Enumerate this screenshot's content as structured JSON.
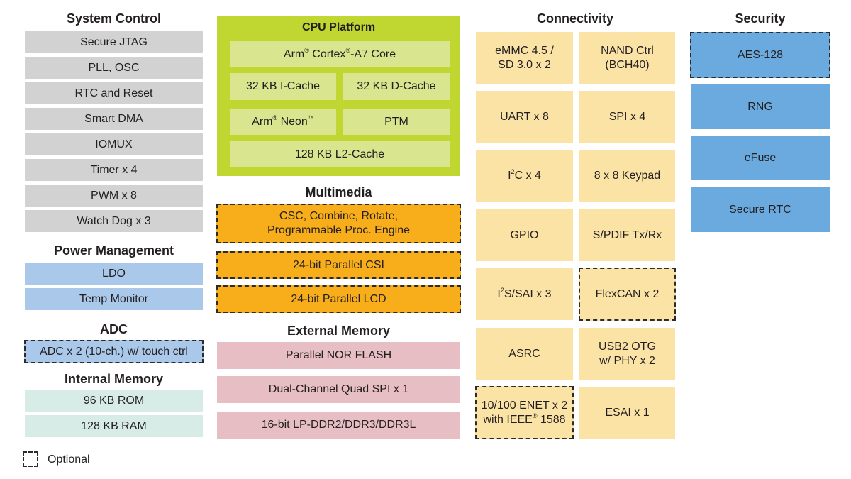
{
  "system_control": {
    "title": "System Control",
    "items": [
      "Secure JTAG",
      "PLL, OSC",
      "RTC and Reset",
      "Smart DMA",
      "IOMUX",
      "Timer x 4",
      "PWM x 8",
      "Watch Dog x 3"
    ]
  },
  "power_management": {
    "title": "Power Management",
    "items": [
      "LDO",
      "Temp Monitor"
    ]
  },
  "adc": {
    "title": "ADC",
    "items": [
      "ADC x 2 (10-ch.) w/ touch ctrl"
    ],
    "optional": [
      true
    ]
  },
  "internal_memory": {
    "title": "Internal Memory",
    "items": [
      "96 KB ROM",
      "128 KB RAM"
    ]
  },
  "cpu_platform": {
    "title": "CPU Platform",
    "core": {
      "prefix": "Arm",
      "reg1": "®",
      "mid": " Cortex",
      "reg2": "®",
      "suffix": "-A7 Core"
    },
    "icache": "32 KB I-Cache",
    "dcache": "32 KB D-Cache",
    "neon": {
      "prefix": "Arm",
      "reg": "®",
      "mid": " Neon",
      "tm": "™"
    },
    "ptm": "PTM",
    "l2cache": "128 KB L2-Cache"
  },
  "multimedia": {
    "title": "Multimedia",
    "items": [
      {
        "line1": "CSC, Combine, Rotate,",
        "line2": "Programmable Proc. Engine",
        "optional": true
      },
      {
        "line1": "24-bit Parallel CSI",
        "optional": true
      },
      {
        "line1": "24-bit Parallel LCD",
        "optional": true
      }
    ]
  },
  "external_memory": {
    "title": "External Memory",
    "items": [
      "Parallel NOR FLASH",
      "Dual-Channel Quad SPI  x 1",
      "16-bit LP-DDR2/DDR3/DDR3L"
    ]
  },
  "connectivity": {
    "title": "Connectivity",
    "emmc": {
      "line1": "eMMC 4.5 /",
      "line2": "SD 3.0 x 2"
    },
    "nand": {
      "line1": "NAND Ctrl",
      "line2": "(BCH40)"
    },
    "uart": "UART x 8",
    "spi": "SPI  x 4",
    "i2c": {
      "prefix": "I",
      "sup": "2",
      "suffix": "C x 4"
    },
    "keypad": "8 x 8 Keypad",
    "gpio": "GPIO",
    "spdif": "S/PDIF Tx/Rx",
    "i2s": {
      "prefix": "I",
      "sup": "2",
      "suffix": "S/SAI x 3"
    },
    "flexcan": {
      "label": "FlexCAN x 2",
      "optional": true
    },
    "asrc": "ASRC",
    "usb": {
      "line1": "USB2 OTG",
      "line2": "w/ PHY x 2"
    },
    "enet": {
      "line1": "10/100 ENET x 2",
      "line2_prefix": "with IEEE",
      "line2_reg": "®",
      "line2_suffix": " 1588",
      "optional": true
    },
    "esai": "ESAI x 1"
  },
  "security": {
    "title": "Security",
    "items": [
      {
        "label": "AES-128",
        "optional": true
      },
      {
        "label": "RNG",
        "optional": false
      },
      {
        "label": "eFuse",
        "optional": false
      },
      {
        "label": "Secure RTC",
        "optional": false
      }
    ]
  },
  "legend": {
    "optional_label": "Optional"
  },
  "colors": {
    "system_control": "#d2d2d2",
    "power_adc": "#a9c8ea",
    "internal_memory": "#d7ece7",
    "cpu_outer": "#bfd730",
    "cpu_inner": "#d9e68f",
    "multimedia": "#f8ae1b",
    "external_memory": "#e6bec3",
    "connectivity": "#fbe3a6",
    "security": "#6aaadf"
  }
}
